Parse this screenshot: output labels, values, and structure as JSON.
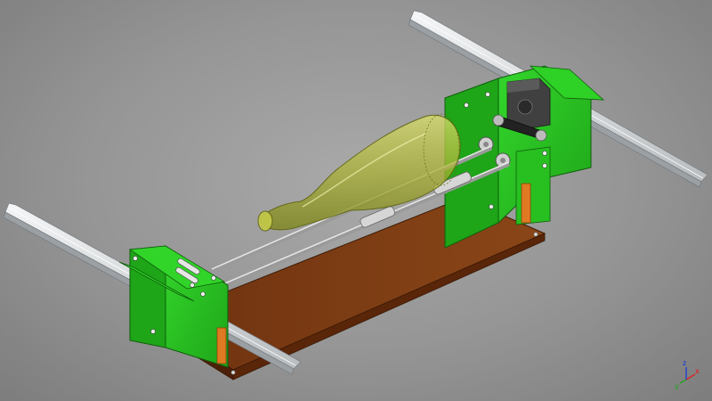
{
  "viewport": {
    "background_top": "#a9a9a9",
    "background_bottom": "#7d7d7d"
  },
  "colors": {
    "bracket_green": "#26c51f",
    "bracket_green_dark": "#148f10",
    "base_board": "#7a3a12",
    "base_board_side": "#5a260a",
    "spacer_orange": "#e07a22",
    "rail_aluminium": "#d9dde0",
    "rod_steel": "#c8c8c8",
    "bottle_glass": "#b4ba3a",
    "motor_dark": "#3c3c3c"
  },
  "parts": [
    "left-rail",
    "right-rail",
    "base-board",
    "front-bracket",
    "rear-bracket",
    "stepper-motor",
    "drive-belt",
    "rod-upper",
    "rod-lower",
    "roller-pair-1",
    "roller-pair-2",
    "wine-bottle",
    "bearing-pair"
  ],
  "axis_indicator": {
    "x_label": "x",
    "y_label": "y",
    "z_label": "z",
    "x_color": "#e11",
    "y_color": "#1a1",
    "z_color": "#13d"
  }
}
